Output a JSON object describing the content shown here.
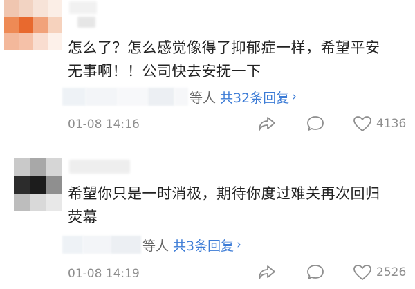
{
  "comments": [
    {
      "text_line1": "怎么了？怎么感觉像得了抑郁症一样，希望平安",
      "text_line2": "无事啊！！公司快去安抚一下",
      "reply_others": "等人",
      "reply_link": "共32条回复",
      "reply_arrow": "›",
      "time": "01-08 14:16",
      "likes": "4136"
    },
    {
      "text_line1": "希望你只是一时消极，期待你度过难关再次回归",
      "text_line2": "荧幕",
      "reply_others": "等人",
      "reply_link": "共3条回复",
      "reply_arrow": "›",
      "time": "01-08 14:19",
      "likes": "2526"
    }
  ],
  "icons": {
    "share": "share-arrow-icon",
    "comment": "comment-bubble-icon",
    "like": "heart-icon"
  },
  "colors": {
    "link": "#3b7bd6",
    "meta": "#8e8e8e",
    "text": "#222222"
  }
}
